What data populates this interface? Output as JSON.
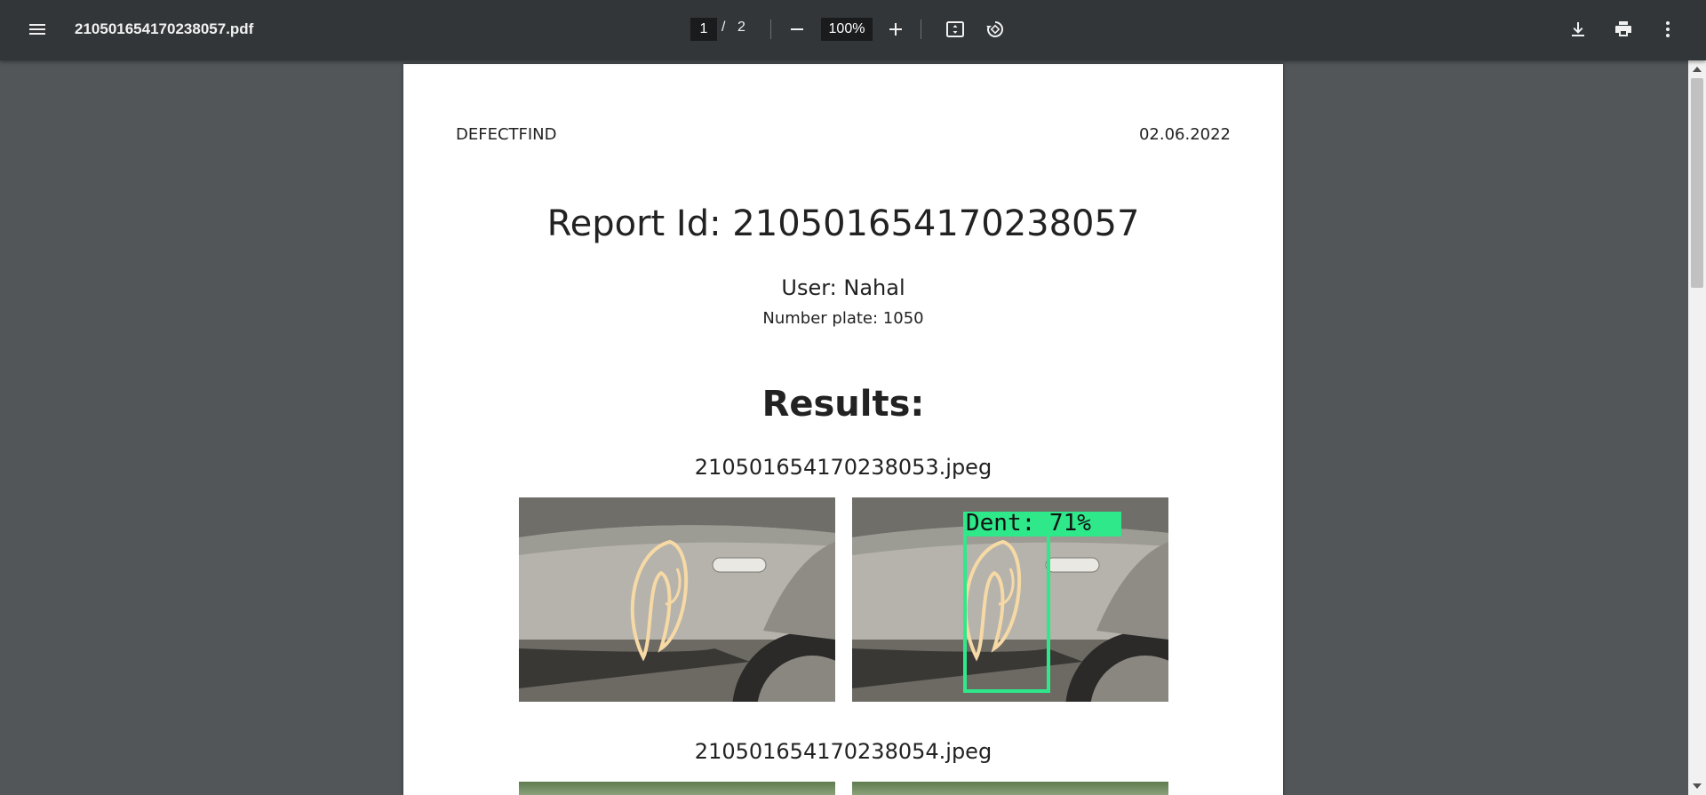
{
  "toolbar": {
    "file_name": "210501654170238057.pdf",
    "current_page": "1",
    "page_separator": "/",
    "total_pages": "2",
    "zoom": "100%",
    "icons": [
      "menu-icon",
      "zoom-out-icon",
      "zoom-in-icon",
      "fit-page-icon",
      "rotate-icon",
      "download-icon",
      "print-icon",
      "more-vert-icon"
    ]
  },
  "document": {
    "brand": "DEFECTFIND",
    "date": "02.06.2022",
    "report_title": "Report Id: 210501654170238057",
    "user": "User: Nahal",
    "number_plate": "Number plate: 1050",
    "results_heading": "Results:",
    "images": [
      {
        "file_name": "210501654170238053.jpeg",
        "detection_label": "Dent: 71%"
      },
      {
        "file_name": "210501654170238054.jpeg"
      }
    ]
  },
  "colors": {
    "toolbar_bg": "#323639",
    "viewer_bg": "#525659",
    "detection_box": "#2ee88a"
  }
}
